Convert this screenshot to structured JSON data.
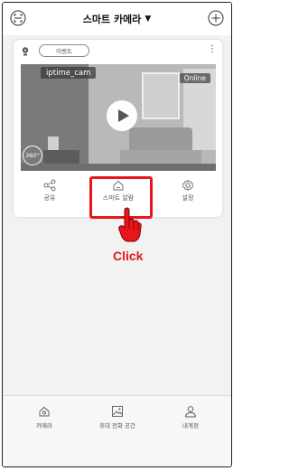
{
  "header": {
    "title": "스마트 카메라",
    "caret": "▼",
    "left_icon": "scan-icon",
    "right_icon": "plus-icon"
  },
  "device_card": {
    "event_chip_label": "이벤트",
    "camera_name": "iptime_cam",
    "status": "Online",
    "badge_360": "360°",
    "actions": [
      {
        "label": "공유",
        "icon": "share-icon"
      },
      {
        "label": "스마트 알람",
        "icon": "home-icon"
      },
      {
        "label": "설정",
        "icon": "gear-icon"
      }
    ]
  },
  "annotation": {
    "click_label": "Click",
    "highlight_color": "#e8161c"
  },
  "tabbar": {
    "tabs": [
      {
        "label": "카메라",
        "icon": "camera-home-icon"
      },
      {
        "label": "휴대 전화 공간",
        "icon": "gallery-icon"
      },
      {
        "label": "내계정",
        "icon": "user-icon"
      }
    ]
  }
}
